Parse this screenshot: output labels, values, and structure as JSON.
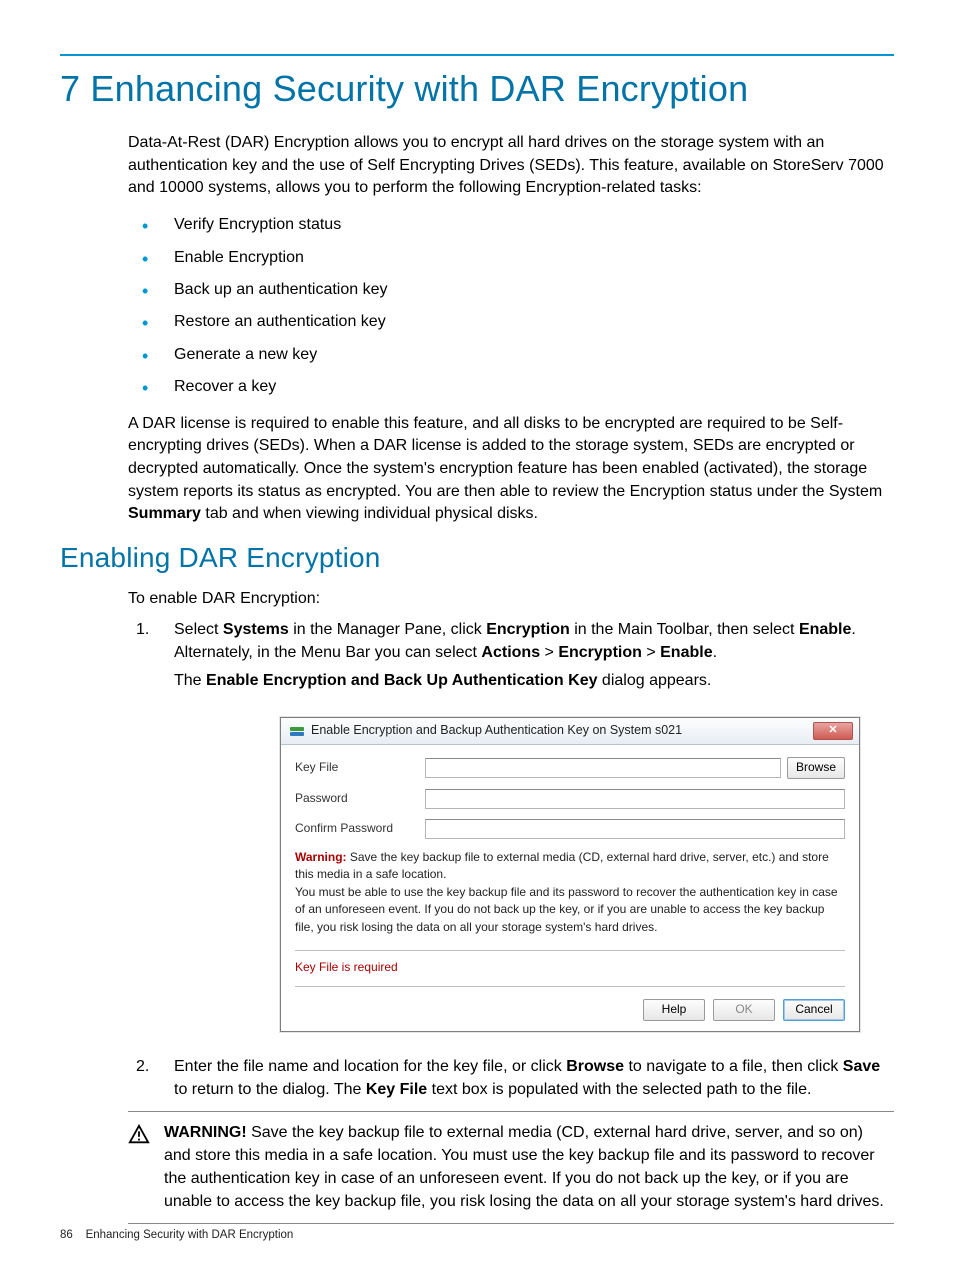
{
  "page": {
    "h1": "7 Enhancing Security with DAR Encryption",
    "intro": "Data-At-Rest (DAR) Encryption allows you to encrypt all hard drives on the storage system with an authentication key and the use of Self Encrypting Drives (SEDs). This feature, available on StoreServ 7000 and 10000 systems, allows you to perform the following Encryption-related tasks:",
    "tasks": [
      "Verify Encryption status",
      "Enable Encryption",
      "Back up an authentication key",
      "Restore an authentication key",
      "Generate a new key",
      "Recover a key"
    ],
    "para_a": "A DAR license is required to enable this feature, and all disks to be encrypted are required to be Self-encrypting drives (SEDs). When a DAR license is added to the storage system, SEDs are encrypted or decrypted automatically. Once the system's encryption feature has been enabled (activated), the storage system reports its status as encrypted. You are then able to review the Encryption status under the System ",
    "para_a_bold": "Summary",
    "para_a_tail": " tab and when viewing individual physical disks.",
    "h2": "Enabling DAR Encryption",
    "enable_lead": "To enable DAR Encryption:",
    "step1": {
      "num": "1.",
      "pre": "Select ",
      "b1": "Systems",
      "t1": " in the Manager Pane, click ",
      "b2": "Encryption",
      "t2": " in the Main Toolbar, then select ",
      "b3": "Enable",
      "t3": ". Alternately, in the Menu Bar you can select ",
      "b4": "Actions",
      "t4": " > ",
      "b5": "Encryption",
      "t5": " > ",
      "b6": "Enable",
      "t6": ".",
      "result_pre": "The ",
      "result_bold": "Enable Encryption and Back Up Authentication Key",
      "result_tail": " dialog appears."
    },
    "step2": {
      "num": "2.",
      "pre": "Enter the file name and location for the key file, or click ",
      "b1": "Browse",
      "t1": " to navigate to a file, then click ",
      "b2": "Save",
      "t2": " to return to the dialog. The ",
      "b3": "Key File",
      "t3": " text box is populated with the selected path to the file."
    }
  },
  "dialog": {
    "title": "Enable Encryption and Backup Authentication Key on System s021",
    "labels": {
      "keyfile": "Key File",
      "password": "Password",
      "confirm": "Confirm Password"
    },
    "browse": "Browse",
    "warning_label": "Warning:",
    "warning_text_1": " Save the key backup file to external media (CD, external hard drive, server, etc.) and store this media in a safe location.",
    "warning_text_2": "You must be able to use the key backup file and its password to recover the authentication key in case of an unforeseen event. If you do not back up the key, or if you are unable to access the key backup file, you risk losing the data on all your storage system's hard drives.",
    "required": "Key File is required",
    "buttons": {
      "help": "Help",
      "ok": "OK",
      "cancel": "Cancel"
    }
  },
  "warning_block": {
    "label": "WARNING!",
    "text": "   Save the key backup file to external media (CD, external hard drive, server, and so on) and store this media in a safe location. You must use the key backup file and its password to recover the authentication key in case of an unforeseen event. If you do not back up the key, or if you are unable to access the key backup file, you risk losing the data on all your storage system's hard drives."
  },
  "footer": {
    "page_no": "86",
    "title": "Enhancing Security with DAR Encryption"
  }
}
